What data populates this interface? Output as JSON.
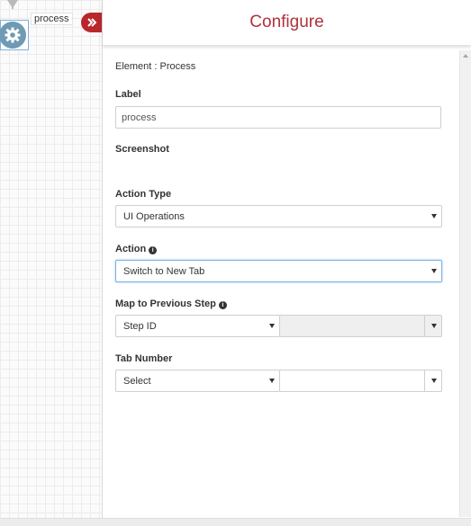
{
  "canvas": {
    "node_label": "process",
    "node_icon": "gear-icon"
  },
  "panel": {
    "title": "Configure",
    "title_color": "#b0313a",
    "accent_color": "#b8262e",
    "element_title": "Element : Process",
    "fields": {
      "label": {
        "label": "Label",
        "value": "process"
      },
      "screenshot": {
        "label": "Screenshot",
        "checked": false
      },
      "action_type": {
        "label": "Action Type",
        "value": "UI Operations"
      },
      "action": {
        "label": "Action",
        "value": "Switch to New Tab"
      },
      "map_previous": {
        "label": "Map to Previous Step",
        "left_value": "Step ID",
        "right_value": ""
      },
      "tab_number": {
        "label": "Tab Number",
        "left_value": "Select",
        "right_value": ""
      }
    }
  }
}
